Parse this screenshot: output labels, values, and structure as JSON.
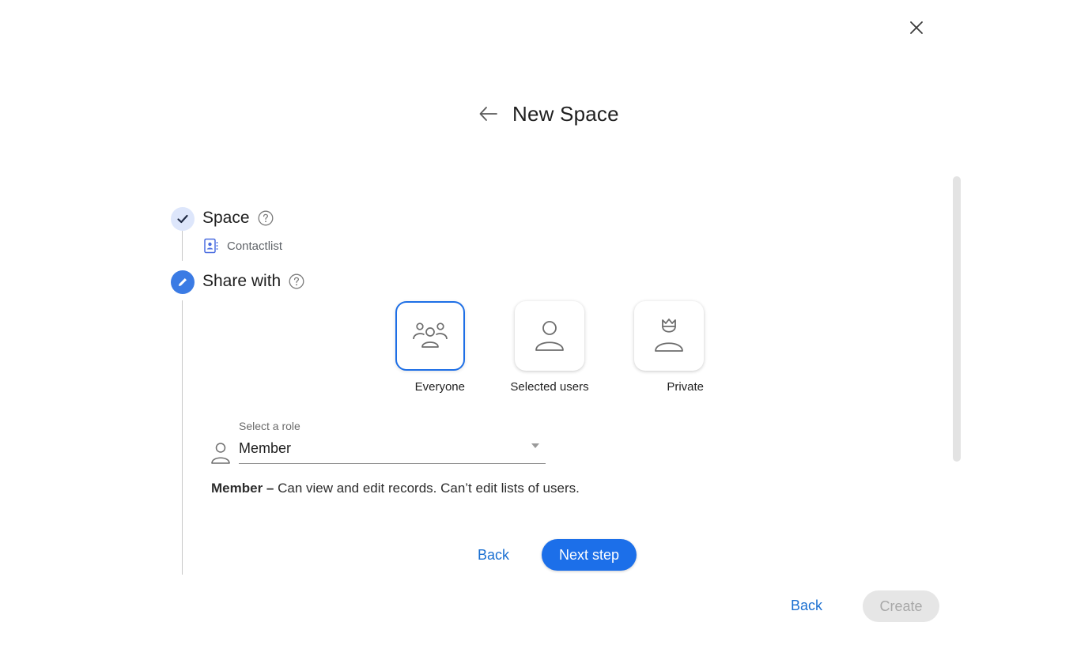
{
  "dialog": {
    "title": "New Space"
  },
  "steps": {
    "space": {
      "title": "Space",
      "value": "Contactlist",
      "status": "completed"
    },
    "share": {
      "title": "Share with",
      "status": "active"
    }
  },
  "share_options": [
    {
      "label": "Everyone",
      "icon": "users-group-icon",
      "selected": true
    },
    {
      "label": "Selected users",
      "icon": "user-icon",
      "selected": false
    },
    {
      "label": "Private",
      "icon": "user-crown-icon",
      "selected": false
    }
  ],
  "role": {
    "label": "Select a role",
    "value": "Member",
    "description_title": "Member –",
    "description_text": " Can view and edit records. Can’t edit lists of users."
  },
  "step_actions": {
    "back_label": "Back",
    "next_label": "Next step"
  },
  "footer": {
    "back_label": "Back",
    "create_label": "Create"
  },
  "colors": {
    "accent": "#1c6fe9",
    "step_done_bg": "#dde6fb",
    "link": "#1a6fd1",
    "disabled_bg": "#e6e6e6"
  }
}
